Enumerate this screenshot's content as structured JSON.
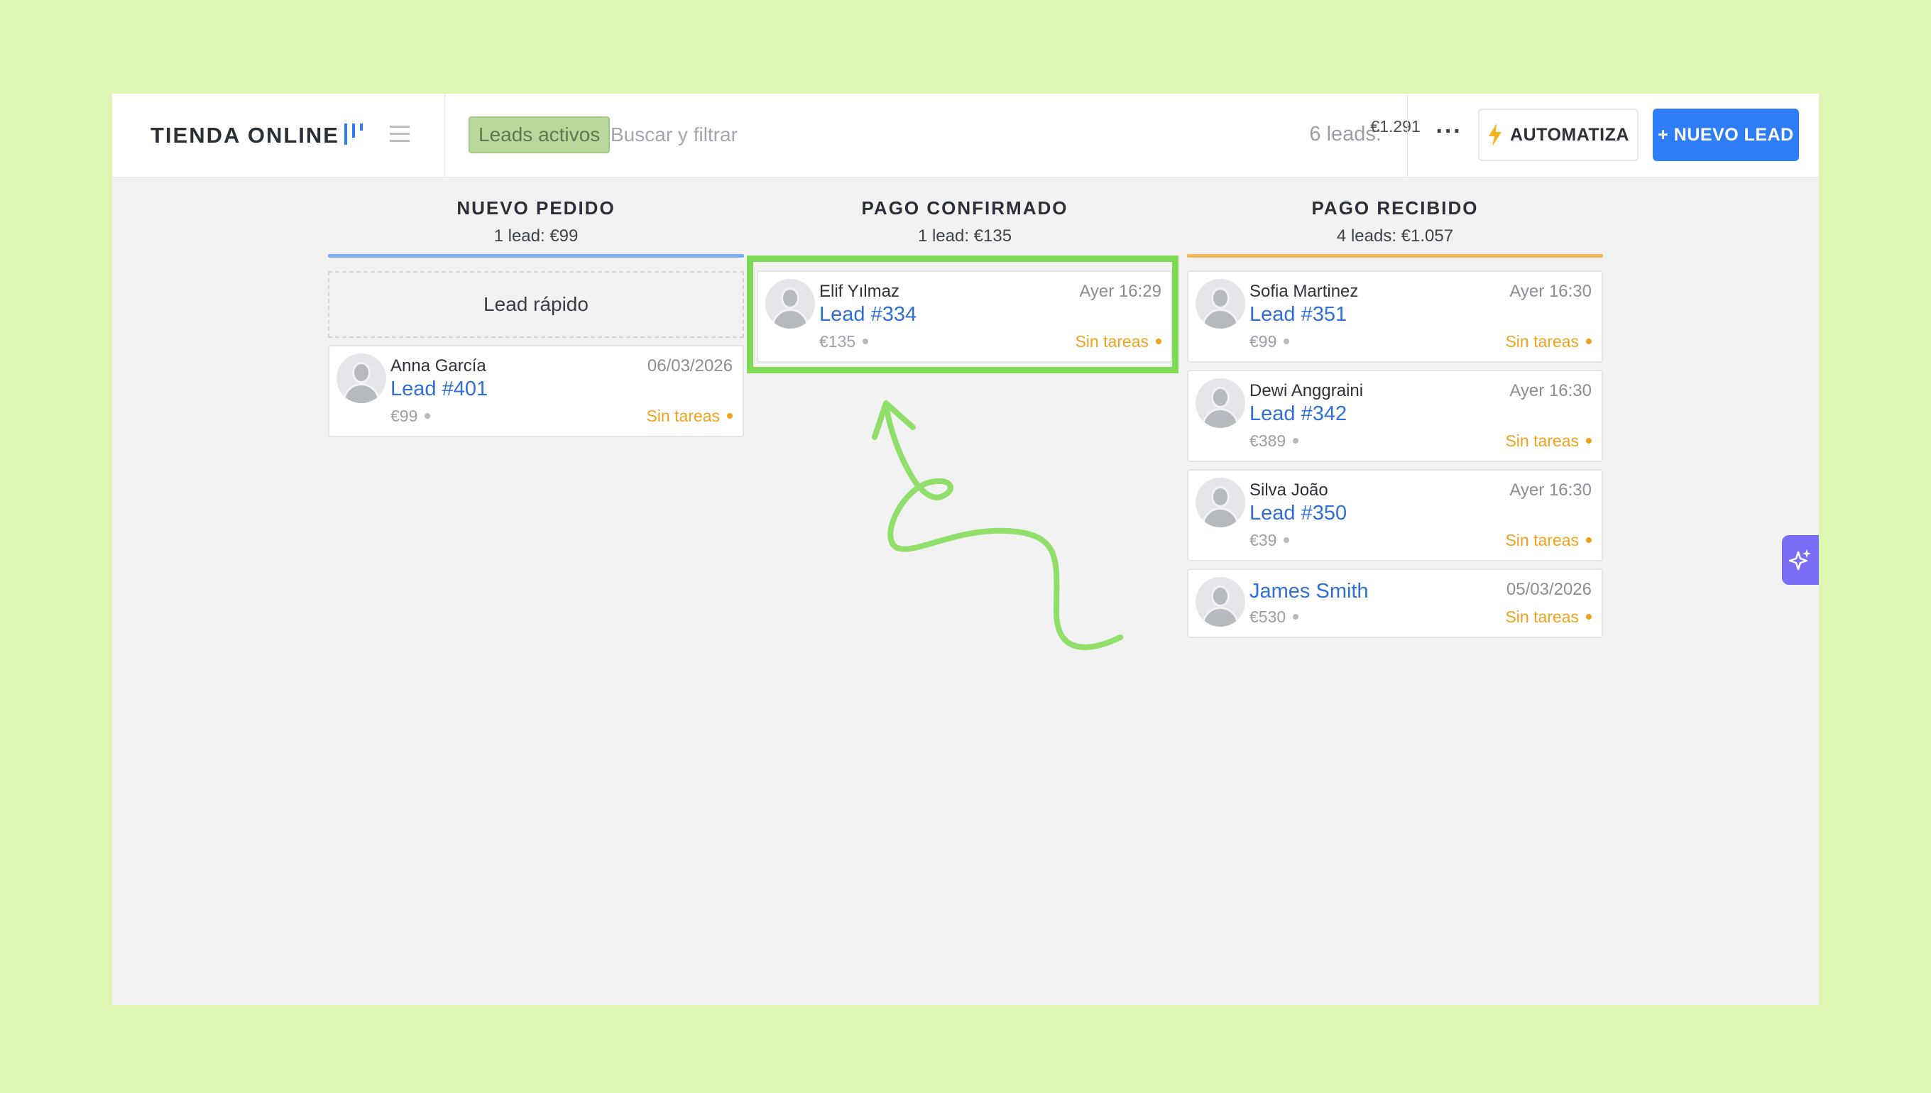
{
  "header": {
    "brand": "TIENDA ONLINE",
    "filter_chip": "Leads activos",
    "search_placeholder": "Buscar y filtrar",
    "summary_count": "6 leads:",
    "summary_amount": "€1.291",
    "more_label": "···",
    "automatiza_label": "AUTOMATIZA",
    "nuevo_lead_label": "+ NUEVO LEAD"
  },
  "columns": [
    {
      "title": "NUEVO PEDIDO",
      "subtitle": "1 lead: €99",
      "color": "#7aaef5",
      "quick_add": "Lead rápido",
      "cards": [
        {
          "contact": "Anna García",
          "lead": "Lead #401",
          "date": "06/03/2026",
          "amount": "€99",
          "tasks": "Sin tareas"
        }
      ]
    },
    {
      "title": "PAGO CONFIRMADO",
      "subtitle": "1 lead: €135",
      "color": "#7ed957",
      "cards": [
        {
          "contact": "Elif Yılmaz",
          "lead": "Lead #334",
          "date": "Ayer 16:29",
          "amount": "€135",
          "tasks": "Sin tareas"
        }
      ]
    },
    {
      "title": "PAGO RECIBIDO",
      "subtitle": "4 leads: €1.057",
      "color": "#f7b55a",
      "cards": [
        {
          "contact": "Sofia Martinez",
          "lead": "Lead #351",
          "date": "Ayer 16:30",
          "amount": "€99",
          "tasks": "Sin tareas"
        },
        {
          "contact": "Dewi Anggraini",
          "lead": "Lead #342",
          "date": "Ayer 16:30",
          "amount": "€389",
          "tasks": "Sin tareas"
        },
        {
          "contact": "Silva João",
          "lead": "Lead #350",
          "date": "Ayer 16:30",
          "amount": "€39",
          "tasks": "Sin tareas"
        },
        {
          "contact": "",
          "lead": "James Smith",
          "date": "05/03/2026",
          "amount": "€530",
          "tasks": "Sin tareas"
        }
      ]
    }
  ],
  "colors": {
    "page_background": "#dff7b3",
    "accent_blue": "#2f7df6",
    "highlight_green": "#7ed957",
    "tasks_orange": "#f0a21b",
    "ai_button": "#7b6cf6"
  },
  "icons": [
    "pipeline-view-icon",
    "list-view-icon",
    "lightning-icon",
    "sparkle-icon",
    "user-avatar-icon"
  ]
}
